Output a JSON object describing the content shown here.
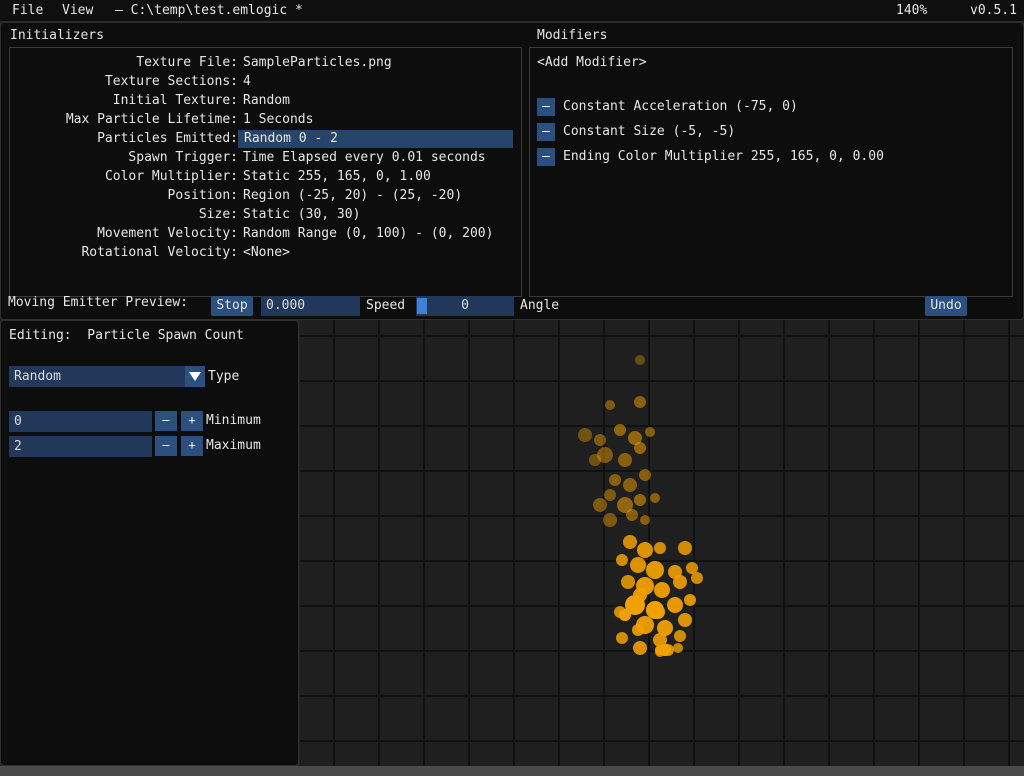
{
  "menubar": {
    "file": "File",
    "view": "View",
    "path": "– C:\\temp\\test.emlogic *",
    "zoom": "140%",
    "version": "v0.5.1"
  },
  "initializers": {
    "title": "Initializers",
    "rows": [
      {
        "label": "Texture File:",
        "value": "SampleParticles.png"
      },
      {
        "label": "Texture Sections:",
        "value": "4"
      },
      {
        "label": "Initial Texture:",
        "value": "Random"
      },
      {
        "label": "Max Particle Lifetime:",
        "value": "1 Seconds"
      },
      {
        "label": "Particles Emitted:",
        "value": "Random 0 - 2"
      },
      {
        "label": "Spawn Trigger:",
        "value": "Time Elapsed every 0.01 seconds"
      },
      {
        "label": "Color Multiplier:",
        "value": "Static 255, 165, 0, 1.00"
      },
      {
        "label": "Position:",
        "value": "Region (-25, 20) - (25, -20)"
      },
      {
        "label": "Size:",
        "value": "Static (30, 30)"
      },
      {
        "label": "Movement Velocity:",
        "value": "Random Range (0, 100) - (0, 200)"
      },
      {
        "label": "Rotational Velocity:",
        "value": "<None>"
      }
    ]
  },
  "modifiers": {
    "title": "Modifiers",
    "add_label": "<Add Modifier>",
    "remove_symbol": "–",
    "items": [
      {
        "label": "Constant Acceleration (-75, 0)"
      },
      {
        "label": "Constant Size (-5, -5)"
      },
      {
        "label": "Ending Color Multiplier 255, 165, 0, 0.00"
      }
    ]
  },
  "preview": {
    "label": "Moving Emitter Preview:",
    "stop_label": "Stop",
    "speed_value": "0.000",
    "speed_label": "Speed",
    "angle_value": "0",
    "angle_label": "Angle",
    "undo_label": "Undo"
  },
  "editor": {
    "title": "Editing:  Particle Spawn Count",
    "type_value": "Random",
    "type_label": "Type",
    "minimum_value": "0",
    "minimum_label": "Minimum",
    "maximum_value": "2",
    "maximum_label": "Maximum",
    "minus_symbol": "–",
    "plus_symbol": "+"
  },
  "colors": {
    "accent": "#2b4f7e",
    "particle": "#f0a000",
    "background": "#0d0d0d"
  }
}
